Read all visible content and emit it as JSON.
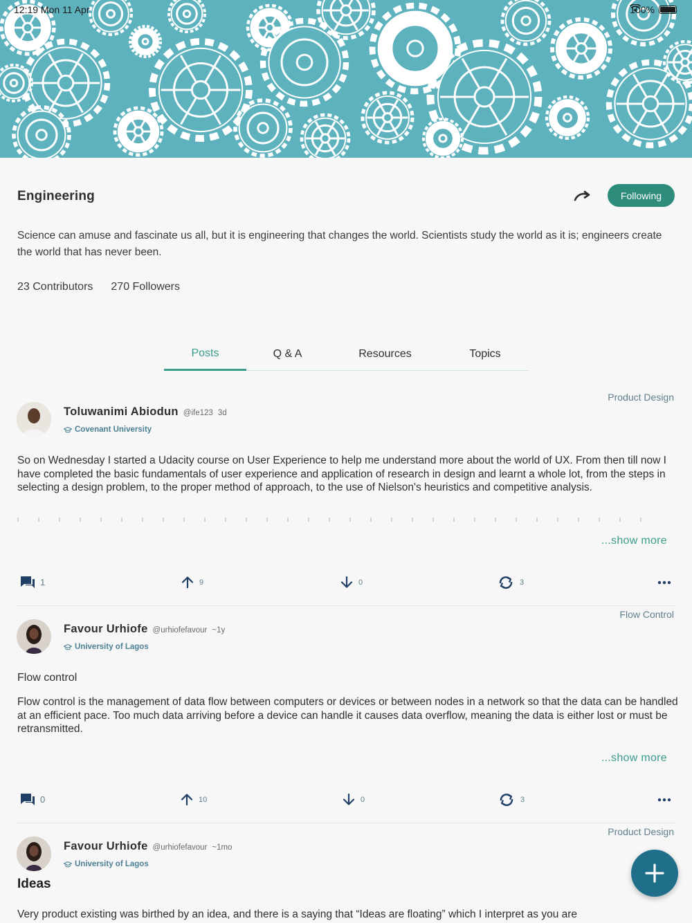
{
  "status_bar": {
    "time": "12:19  Mon 11 Apr",
    "battery": "100%"
  },
  "topic": {
    "title": "Engineering",
    "follow_label": "Following",
    "description": "Science can amuse and fascinate us all, but it is engineering that changes the world. Scientists study the world as it is; engineers create the world that has never been.",
    "contributors": "23 Contributors",
    "followers": "270 Followers"
  },
  "tabs": [
    {
      "label": "Posts",
      "active": true
    },
    {
      "label": "Q & A",
      "active": false
    },
    {
      "label": "Resources",
      "active": false
    },
    {
      "label": "Topics",
      "active": false
    }
  ],
  "posts": [
    {
      "category": "Product Design",
      "author": "Toluwanimi Abiodun",
      "handle": "@ife123",
      "time": "3d",
      "school": "Covenant University",
      "body": "So on Wednesday I started a Udacity course on User Experience to help me understand more about the world of UX. From then till now I have completed the basic fundamentals of user experience and application of research in design and learnt a whole lot, from the steps in selecting a design problem, to the proper method of approach, to the use of Nielson's heuristics and competitive analysis.",
      "show_more": "...show more",
      "comments": "1",
      "upvotes": "9",
      "downvotes": "0",
      "reposts": "3"
    },
    {
      "category": "Flow Control",
      "author": "Favour Urhiofe",
      "handle": "@urhiofefavour",
      "time": "~1y",
      "school": "University of Lagos",
      "heading": "Flow control",
      "body": "Flow control is the management of data flow between computers or devices or between nodes in a network so that the data can be handled at an efficient pace. Too much data arriving before a device can handle it causes data overflow, meaning the data is either lost or must be retransmitted.",
      "show_more": "...show more",
      "comments": "0",
      "upvotes": "10",
      "downvotes": "0",
      "reposts": "3"
    },
    {
      "category": "Product Design",
      "author": "Favour Urhiofe",
      "handle": "@urhiofefavour",
      "time": "~1mo",
      "school": "University of Lagos",
      "heading": "Ideas",
      "body": "Very product existing was birthed by an idea, and there is a saying that “Ideas are floating” which I interpret as you are"
    }
  ],
  "colors": {
    "accent": "#2d8c7c",
    "tab_active": "#3a9d8c",
    "banner": "#5db2be",
    "school_link": "#4c7f93",
    "fab": "#1f6f8b"
  }
}
